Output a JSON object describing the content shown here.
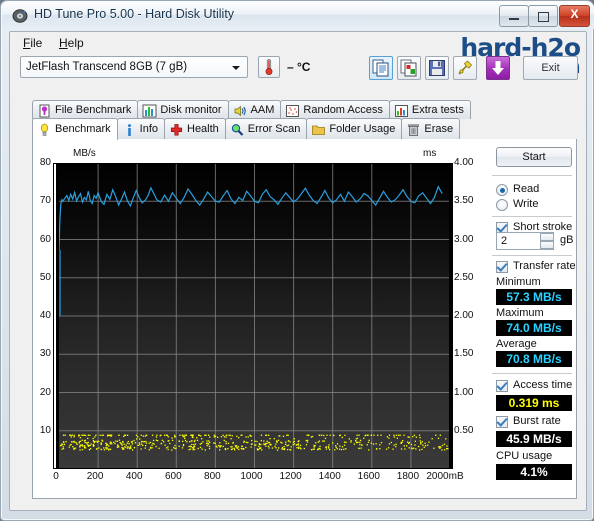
{
  "window": {
    "title": "HD Tune Pro 5.00 - Hard Disk Utility",
    "icon": "hdtune-icon",
    "minimize_label": "Minimize",
    "maximize_label": "Maximize",
    "close_label": "X"
  },
  "menu": {
    "items": [
      {
        "label": "File",
        "mnemonic": "F"
      },
      {
        "label": "Help",
        "mnemonic": "H"
      }
    ]
  },
  "watermark": {
    "line1": "hard-h2o",
    "line2": ".com"
  },
  "toolbar": {
    "drive_value": "JetFlash Transcend 8GB   (7 gB)",
    "temperature": "– °C",
    "exit_label": "Exit",
    "buttons": [
      {
        "name": "copy-icon",
        "label": "Copy",
        "selected": true
      },
      {
        "name": "copy-image-icon",
        "label": "Copy image",
        "selected": false
      },
      {
        "name": "save-icon",
        "label": "Save",
        "selected": false
      },
      {
        "name": "options-icon",
        "label": "Options",
        "selected": false
      },
      {
        "name": "download-icon",
        "label": "Update",
        "selected": false
      }
    ]
  },
  "tabs": {
    "row1": [
      {
        "label": "File Benchmark",
        "icon": "file-benchmark-icon",
        "active": false
      },
      {
        "label": "Disk monitor",
        "icon": "disk-monitor-icon",
        "active": false
      },
      {
        "label": "AAM",
        "icon": "speaker-icon",
        "active": false
      },
      {
        "label": "Random Access",
        "icon": "random-access-icon",
        "active": false
      },
      {
        "label": "Extra tests",
        "icon": "extra-tests-icon",
        "active": false
      }
    ],
    "row2": [
      {
        "label": "Benchmark",
        "icon": "bulb-icon",
        "active": true
      },
      {
        "label": "Info",
        "icon": "info-icon",
        "active": false
      },
      {
        "label": "Health",
        "icon": "health-cross-icon",
        "active": false
      },
      {
        "label": "Error Scan",
        "icon": "magnifier-icon",
        "active": false
      },
      {
        "label": "Folder Usage",
        "icon": "folder-icon",
        "active": false
      },
      {
        "label": "Erase",
        "icon": "trash-icon",
        "active": false
      }
    ]
  },
  "side_panel": {
    "start_label": "Start",
    "mode_read": "Read",
    "mode_write": "Write",
    "mode_selected": "Read",
    "short_stroke_label": "Short stroke",
    "short_stroke_checked": true,
    "short_stroke_value": "2",
    "short_stroke_unit": "gB",
    "transfer_rate_label": "Transfer rate",
    "transfer_rate_checked": true,
    "minimum_label": "Minimum",
    "minimum_value": "57.3 MB/s",
    "maximum_label": "Maximum",
    "maximum_value": "74.0 MB/s",
    "average_label": "Average",
    "average_value": "70.8 MB/s",
    "access_time_label": "Access time",
    "access_time_checked": true,
    "access_time_value": "0.319 ms",
    "burst_rate_label": "Burst rate",
    "burst_rate_checked": true,
    "burst_rate_value": "45.9 MB/s",
    "cpu_usage_label": "CPU usage",
    "cpu_usage_value": "4.1%"
  },
  "colors": {
    "transfer_line": "#2a9fe0",
    "access_dots": "#ffff00",
    "lcd_cyan": "#2ad2ff",
    "lcd_yellow": "#ffff00",
    "lcd_white": "#ffffff",
    "watermark": "#1d4d86",
    "plot_bg_top": "#000000",
    "plot_bg_bottom": "#3a3a3a",
    "grid": "#8a8a8a"
  },
  "chart_data": {
    "type": "line",
    "title": "",
    "xlabel": "mB",
    "ylabel": "MB/s",
    "y2label": "ms",
    "xlim": [
      0,
      2000
    ],
    "ylim": [
      0,
      80
    ],
    "y2lim": [
      0,
      4.0
    ],
    "grid": true,
    "xticks": [
      0,
      200,
      400,
      600,
      800,
      1000,
      1200,
      1400,
      1600,
      1800,
      2000
    ],
    "xtick_labels": [
      "0",
      "200",
      "400",
      "600",
      "800",
      "1000",
      "1200",
      "1400",
      "1600",
      "1800",
      "2000mB"
    ],
    "yticks": [
      10,
      20,
      30,
      40,
      50,
      60,
      70,
      80
    ],
    "ytick_labels": [
      "10",
      "20",
      "30",
      "40",
      "50",
      "60",
      "70",
      "80"
    ],
    "y2ticks": [
      0.5,
      1.0,
      1.5,
      2.0,
      2.5,
      3.0,
      3.5,
      4.0
    ],
    "y2tick_labels": [
      "0.50",
      "1.00",
      "1.50",
      "2.00",
      "2.50",
      "3.00",
      "3.50",
      "4.00"
    ],
    "series": [
      {
        "name": "Transfer rate",
        "color": "#2a9fe0",
        "axis": "left",
        "unit": "MB/s",
        "x": [
          0,
          5,
          10,
          15,
          20,
          30,
          40,
          50,
          60,
          70,
          80,
          90,
          100,
          110,
          120,
          130,
          140,
          150,
          160,
          170,
          180,
          190,
          200,
          215,
          230,
          245,
          260,
          275,
          290,
          305,
          320,
          335,
          350,
          365,
          380,
          395,
          410,
          425,
          440,
          455,
          470,
          485,
          500,
          520,
          540,
          560,
          580,
          600,
          620,
          640,
          660,
          680,
          700,
          720,
          740,
          760,
          780,
          800,
          820,
          840,
          860,
          880,
          900,
          920,
          940,
          960,
          980,
          1000,
          1020,
          1040,
          1060,
          1080,
          1100,
          1120,
          1140,
          1160,
          1180,
          1200,
          1220,
          1240,
          1260,
          1280,
          1300,
          1320,
          1340,
          1360,
          1380,
          1400,
          1420,
          1440,
          1460,
          1480,
          1500,
          1520,
          1540,
          1560,
          1580,
          1600,
          1620,
          1640,
          1660,
          1680,
          1700,
          1720,
          1740,
          1760,
          1780,
          1800,
          1820,
          1840,
          1860,
          1880,
          1900,
          1920,
          1940,
          1960,
          1980,
          2000
        ],
        "y": [
          57.3,
          66.0,
          69.5,
          70.4,
          70.0,
          70.8,
          71.5,
          70.2,
          71.8,
          70.6,
          72.3,
          70.1,
          71.2,
          72.0,
          69.8,
          71.0,
          70.4,
          72.6,
          70.2,
          69.4,
          71.5,
          70.8,
          72.2,
          70.0,
          69.2,
          71.8,
          70.5,
          73.0,
          71.2,
          69.0,
          70.6,
          72.4,
          70.1,
          68.8,
          70.9,
          72.8,
          71.0,
          69.6,
          70.2,
          71.4,
          73.5,
          72.0,
          70.4,
          69.8,
          71.6,
          70.0,
          72.2,
          70.8,
          69.4,
          71.0,
          73.2,
          71.8,
          70.2,
          69.0,
          70.6,
          72.4,
          71.2,
          70.0,
          69.8,
          71.4,
          72.8,
          70.6,
          69.4,
          71.0,
          70.2,
          72.6,
          71.4,
          70.0,
          69.6,
          71.8,
          73.0,
          71.2,
          70.4,
          69.2,
          70.8,
          72.2,
          71.0,
          69.8,
          70.6,
          72.0,
          73.4,
          71.6,
          70.2,
          69.4,
          71.0,
          72.8,
          70.8,
          69.6,
          70.4,
          71.8,
          70.0,
          72.4,
          71.2,
          69.8,
          70.6,
          72.0,
          71.4,
          70.2,
          69.0,
          70.8,
          72.6,
          71.0,
          69.8,
          70.4,
          71.6,
          73.0,
          71.2,
          70.0,
          69.6,
          71.4,
          72.2,
          70.8,
          69.4,
          71.0,
          73.8,
          72.0
        ]
      },
      {
        "name": "Access time",
        "color": "#ffff00",
        "axis": "right",
        "unit": "ms",
        "style": "dots",
        "mean": 0.319,
        "spread": [
          0.22,
          0.45
        ]
      }
    ]
  }
}
